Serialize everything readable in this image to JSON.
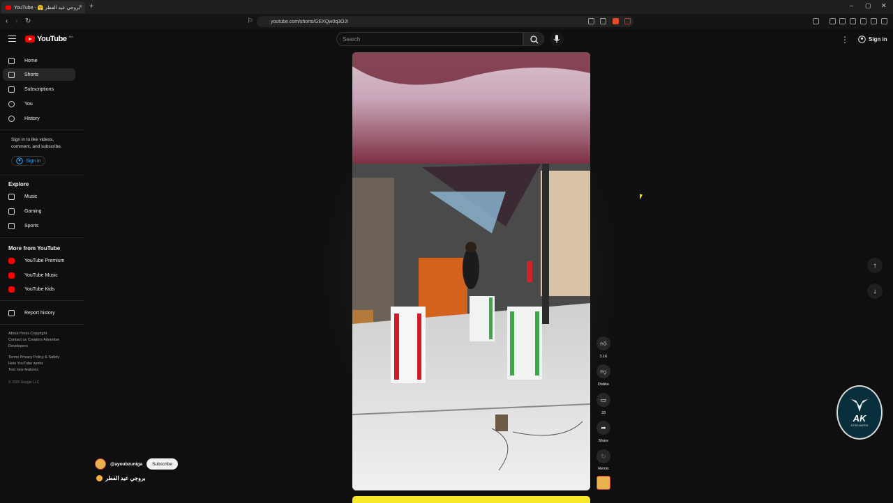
{
  "browser": {
    "tab_title": "YouTube - 🤗 بروجي عيد الفطر",
    "url": "youtube.com/shorts/GEXQw0q3OJI",
    "new_tab": "+",
    "window_buttons": [
      "–",
      "▢",
      "✕"
    ]
  },
  "header": {
    "logo_text": "YouTube",
    "country_code": "MA",
    "search_placeholder": "Search",
    "signin_label": "Sign in"
  },
  "sidebar": {
    "main_items": [
      {
        "label": "Home",
        "icon": "home-icon"
      },
      {
        "label": "Shorts",
        "icon": "shorts-icon",
        "active": true
      },
      {
        "label": "Subscriptions",
        "icon": "subscriptions-icon"
      },
      {
        "label": "You",
        "icon": "you-icon"
      },
      {
        "label": "History",
        "icon": "history-icon"
      }
    ],
    "signin_prompt": "Sign in to like videos, comment, and subscribe.",
    "signin_button": "Sign in",
    "explore_title": "Explore",
    "explore_items": [
      {
        "label": "Music",
        "icon": "music-icon"
      },
      {
        "label": "Gaming",
        "icon": "gaming-icon"
      },
      {
        "label": "Sports",
        "icon": "sports-icon"
      }
    ],
    "more_title": "More from YouTube",
    "more_items": [
      {
        "label": "YouTube Premium",
        "icon": "youtube-premium-icon"
      },
      {
        "label": "YouTube Music",
        "icon": "youtube-music-icon"
      },
      {
        "label": "YouTube Kids",
        "icon": "youtube-kids-icon"
      }
    ],
    "report_history": "Report history",
    "footer_line1": "About  Press  Copyright",
    "footer_line2": "Contact us  Creators  Advertise",
    "footer_line3": "Developers",
    "footer_line4": "Terms  Privacy  Policy & Safety",
    "footer_line5": "How YouTube works",
    "footer_line6": "Test new features",
    "copyright": "© 2025 Google LLC"
  },
  "short": {
    "channel_handle": "@ayoubzuniga",
    "subscribe_label": "Subscribe",
    "title": "بروجي عيد الفطر",
    "actions": {
      "likes": "3.1K",
      "dislike": "Dislike",
      "comments": "33",
      "share": "Share",
      "remix": "Remix"
    }
  },
  "watermark": {
    "line1": "AK",
    "line2": "STREAMERS"
  },
  "colors": {
    "background": "#0f0f0f",
    "brand_red": "#ff0000",
    "link_blue": "#3ea6ff",
    "progress_yellow": "#f7e82a"
  }
}
